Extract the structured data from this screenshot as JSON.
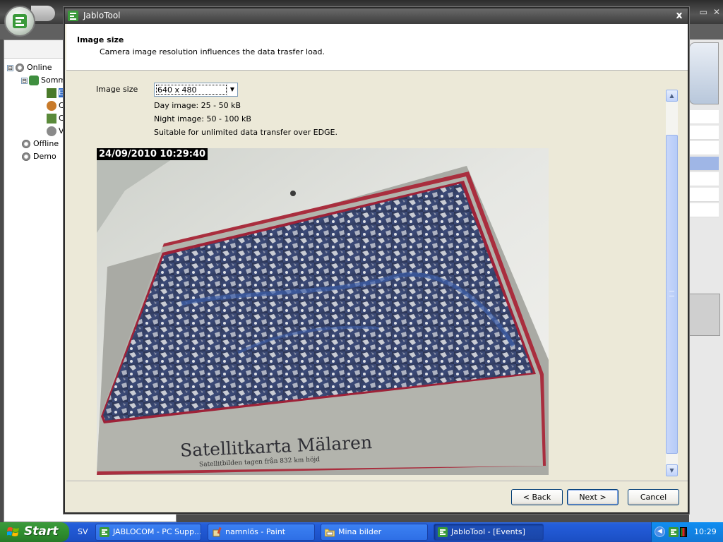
{
  "background": {
    "tree": [
      {
        "label": "Online",
        "expander": "⊟"
      },
      {
        "label": "Somm",
        "expander": "⊟"
      },
      {
        "label": "Ev"
      },
      {
        "label": "Ce"
      },
      {
        "label": "Co"
      },
      {
        "label": "Vi"
      },
      {
        "label": "Offline"
      },
      {
        "label": "Demo"
      }
    ]
  },
  "dialog": {
    "title": "JabloTool",
    "close_glyph": "x",
    "header": {
      "title": "Image size",
      "description": "Camera image resolution influences the data trasfer load."
    },
    "image_size": {
      "label": "Image size",
      "selected": "640 x 480",
      "day_info": "Day image: 25 - 50 kB",
      "night_info": "Night image: 50 - 100 kB",
      "edge_info": "Suitable for unlimited data transfer over EDGE."
    },
    "camera_image": {
      "timestamp": "24/09/2010 10:29:40",
      "caption": "Satellitkarta Mälaren",
      "subcaption": "Satellitbilden tagen från 832 km höjd"
    },
    "buttons": {
      "back": "< Back",
      "next": "Next >",
      "cancel": "Cancel"
    }
  },
  "taskbar": {
    "start_label": "Start",
    "language": "SV",
    "tasks": [
      {
        "label": "JABLOCOM - PC Supp...",
        "icon": "jablotool-icon"
      },
      {
        "label": "namnlös - Paint",
        "icon": "paint-icon"
      },
      {
        "label": "Mina bilder",
        "icon": "folder-icon"
      },
      {
        "label": "JabloTool - [Events]",
        "icon": "jablotool-icon"
      }
    ],
    "clock": "10:29"
  },
  "colors": {
    "taskbar_blue": "#245edb",
    "start_green": "#2f8f2f",
    "selection_blue": "#316ac5",
    "dialog_face": "#ece9d8"
  }
}
